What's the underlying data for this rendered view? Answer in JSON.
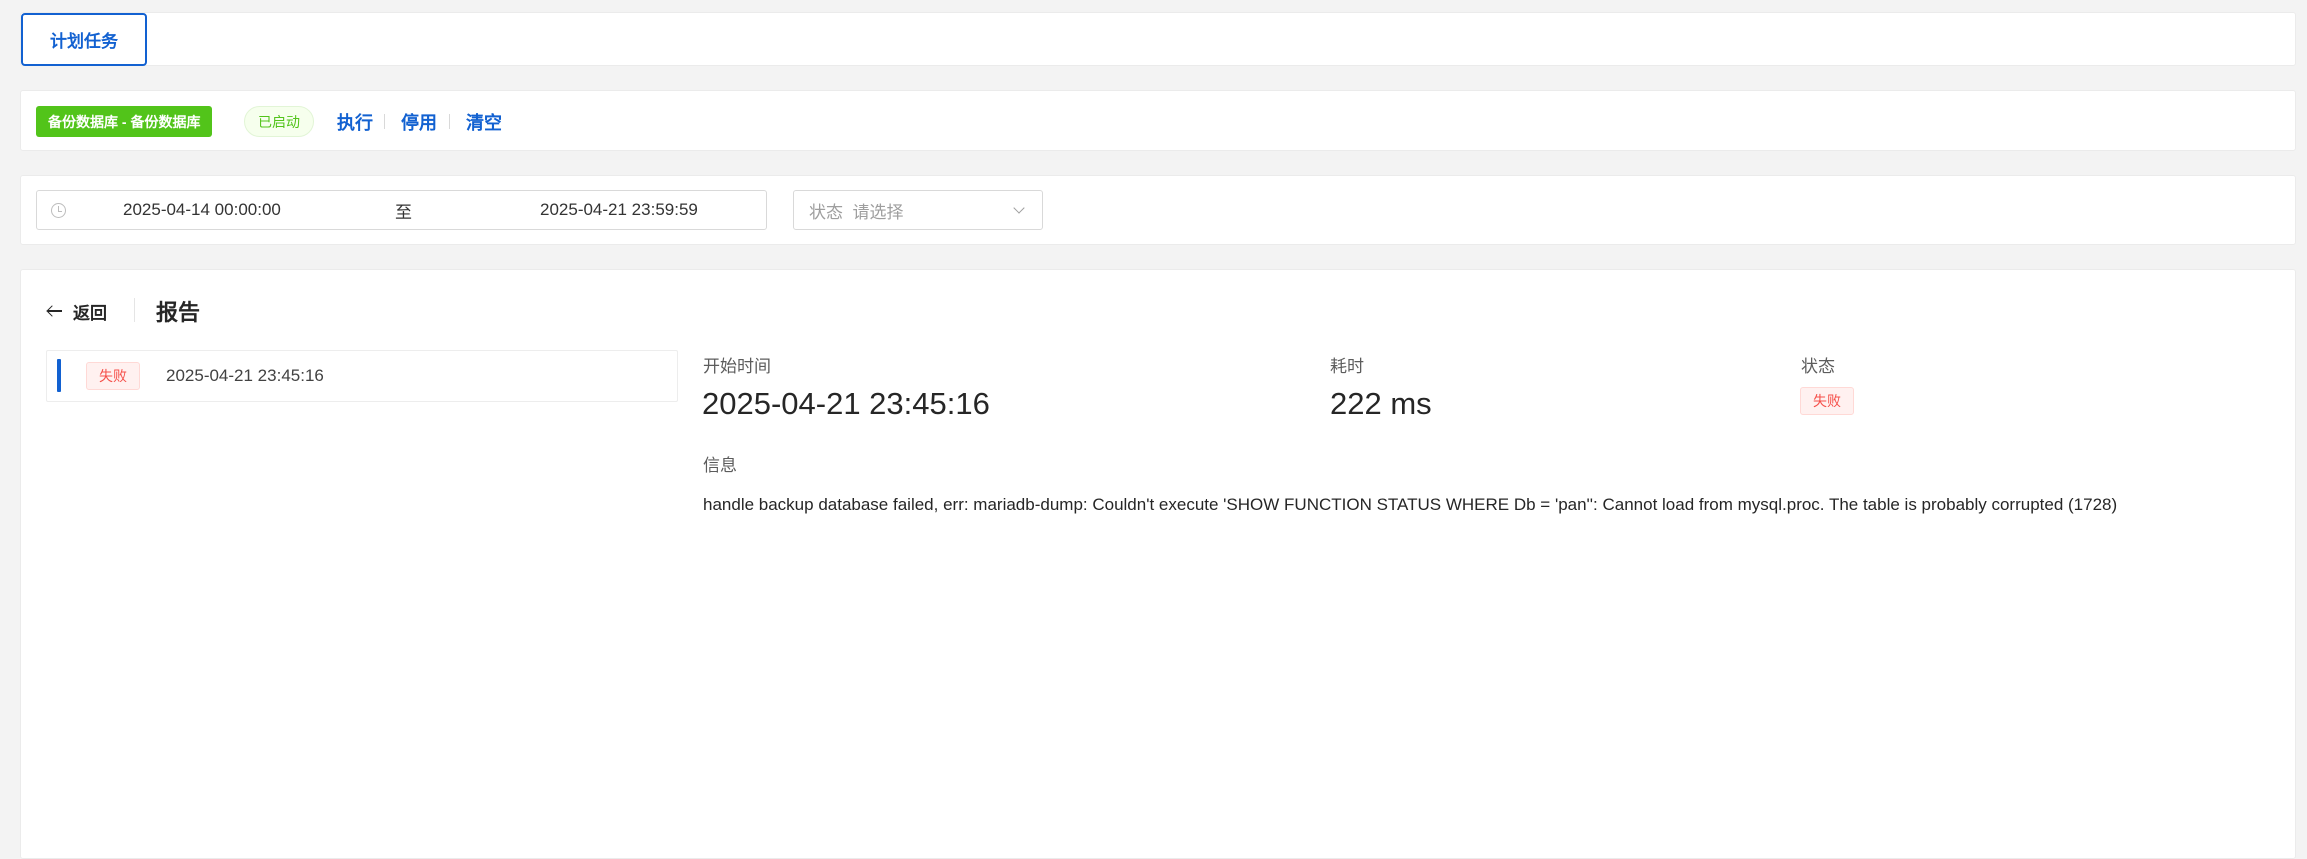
{
  "tabs": [
    {
      "label": "计划任务"
    }
  ],
  "task": {
    "tag": "备份数据库 - 备份数据库",
    "enabled_badge": "已启动",
    "actions": {
      "execute": "执行",
      "disable": "停用",
      "clear": "清空"
    }
  },
  "filter": {
    "start_date": "2025-04-14 00:00:00",
    "separator": "至",
    "end_date": "2025-04-21 23:59:59",
    "status_label": "状态",
    "status_placeholder": "请选择"
  },
  "report": {
    "back_label": "返回",
    "title": "报告",
    "runs": [
      {
        "status": "失败",
        "time": "2025-04-21 23:45:16"
      }
    ],
    "detail": {
      "start_time_label": "开始时间",
      "start_time": "2025-04-21 23:45:16",
      "duration_label": "耗时",
      "duration": "222 ms",
      "status_label": "状态",
      "status": "失败",
      "message_label": "信息",
      "message": "handle backup database failed, err: mariadb-dump: Couldn't execute 'SHOW FUNCTION STATUS WHERE Db = 'pan'': Cannot load from mysql.proc. The table is probably corrupted (1728)"
    }
  },
  "colors": {
    "primary": "#1261d1",
    "success": "#52c41a",
    "danger": "#f5504a",
    "background": "#f3f3f3"
  }
}
